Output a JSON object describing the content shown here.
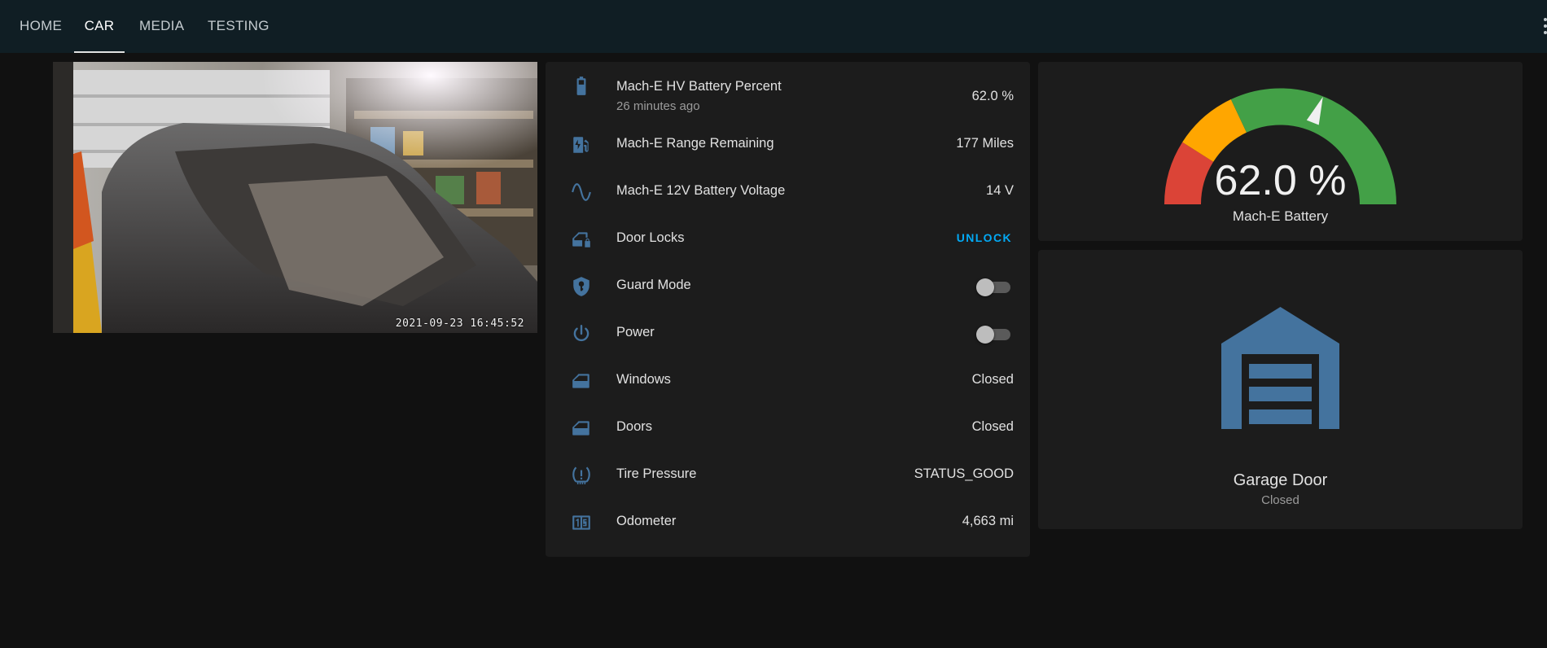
{
  "nav": {
    "tabs": [
      {
        "label": "HOME"
      },
      {
        "label": "CAR",
        "active": true
      },
      {
        "label": "MEDIA"
      },
      {
        "label": "TESTING"
      }
    ],
    "menu_icon": "dots-vertical-icon"
  },
  "camera": {
    "timestamp": "2021-09-23 16:45:52"
  },
  "entities": [
    {
      "icon": "battery-icon",
      "label": "Mach-E HV Battery Percent",
      "secondary": "26 minutes ago",
      "value": "62.0 %"
    },
    {
      "icon": "ev-station-icon",
      "label": "Mach-E Range Remaining",
      "value": "177 Miles"
    },
    {
      "icon": "sine-wave-icon",
      "label": "Mach-E 12V Battery Voltage",
      "value": "14 V"
    },
    {
      "icon": "car-door-lock-icon",
      "label": "Door Locks",
      "action": "UNLOCK"
    },
    {
      "icon": "shield-key-icon",
      "label": "Guard Mode",
      "toggle": false
    },
    {
      "icon": "power-icon",
      "label": "Power",
      "toggle": false
    },
    {
      "icon": "car-door-icon",
      "label": "Windows",
      "value": "Closed"
    },
    {
      "icon": "car-door-icon",
      "label": "Doors",
      "value": "Closed"
    },
    {
      "icon": "tire-pressure-icon",
      "label": "Tire Pressure",
      "value": "STATUS_GOOD"
    },
    {
      "icon": "counter-icon",
      "label": "Odometer",
      "value": "4,663 mi"
    }
  ],
  "gauge": {
    "value_text": "62.0 %",
    "value": 62.0,
    "min": 0,
    "max": 100,
    "name": "Mach-E Battery",
    "severity_colors": {
      "red": "#db4437",
      "yellow": "#ffa600",
      "green": "#43a047"
    }
  },
  "garage": {
    "icon": "garage-icon",
    "name": "Garage Door",
    "state": "Closed"
  },
  "colors": {
    "background": "#111111",
    "card": "#1c1c1c",
    "topbar": "#101e24",
    "icon": "#44739e",
    "accent": "#03a9f4"
  }
}
